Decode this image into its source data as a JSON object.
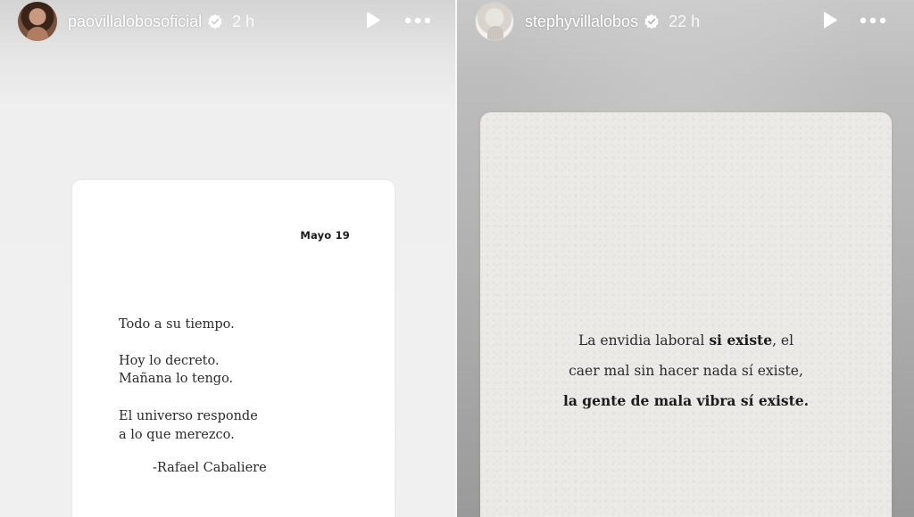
{
  "stories": [
    {
      "username": "paovillalobosoficial",
      "time": "2 h",
      "verified": true,
      "card": {
        "date": "Mayo 19",
        "lines": [
          "Todo a su tiempo.",
          "Hoy lo decreto.",
          "Mañana lo tengo.",
          "El universo responde",
          "a lo que merezco."
        ],
        "attribution": "-Rafael Cabaliere"
      }
    },
    {
      "username": "stephyvillalobos",
      "time": "22 h",
      "verified": true,
      "card": {
        "line1": {
          "normal": "La envidia laboral ",
          "bold": "si existe",
          "tail": ", el"
        },
        "line2": "caer mal sin hacer nada sí existe,",
        "line3_bold": "la gente de mala vibra sí existe."
      }
    }
  ],
  "icons": {
    "play": "play-icon",
    "more": "more-horizontal-icon",
    "verified": "verified-badge-icon"
  },
  "colors": {
    "verified_badge": "#ffffff",
    "header_text": "#ffffff"
  }
}
